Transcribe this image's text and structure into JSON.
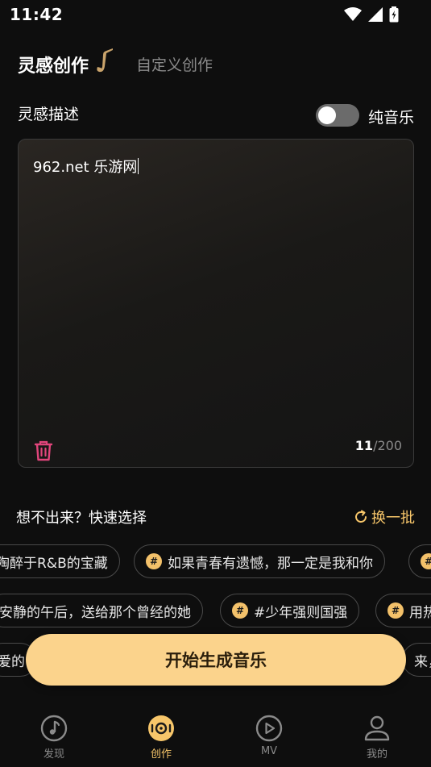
{
  "status": {
    "time": "11:42"
  },
  "tabs": {
    "active": "灵感创作",
    "inactive": "自定义创作"
  },
  "inspiration": {
    "label": "灵感描述",
    "toggle_label": "纯音乐",
    "toggle_on": false,
    "input_value": "962.net 乐游网",
    "count_current": "11",
    "count_max": "/200"
  },
  "quick": {
    "title": "想不出来？快速选择",
    "refresh_label": "换一批",
    "rows": [
      [
        "陶醉于R&B的宝藏",
        "如果青春有遗憾，那一定是我和你",
        ""
      ],
      [
        "安静的午后，送给那个曾经的她",
        "#少年强则国强",
        "用热"
      ],
      [
        "爱的",
        "来，"
      ]
    ]
  },
  "generate_label": "开始生成音乐",
  "nav": [
    {
      "label": "发现",
      "icon": "music-note-icon",
      "active": false
    },
    {
      "label": "创作",
      "icon": "vinyl-disc-icon",
      "active": true
    },
    {
      "label": "MV",
      "icon": "play-icon",
      "active": false
    },
    {
      "label": "我的",
      "icon": "profile-icon",
      "active": false
    }
  ],
  "colors": {
    "accent": "#f7c66a",
    "button": "#fbd38c",
    "delete": "#e0457b"
  }
}
